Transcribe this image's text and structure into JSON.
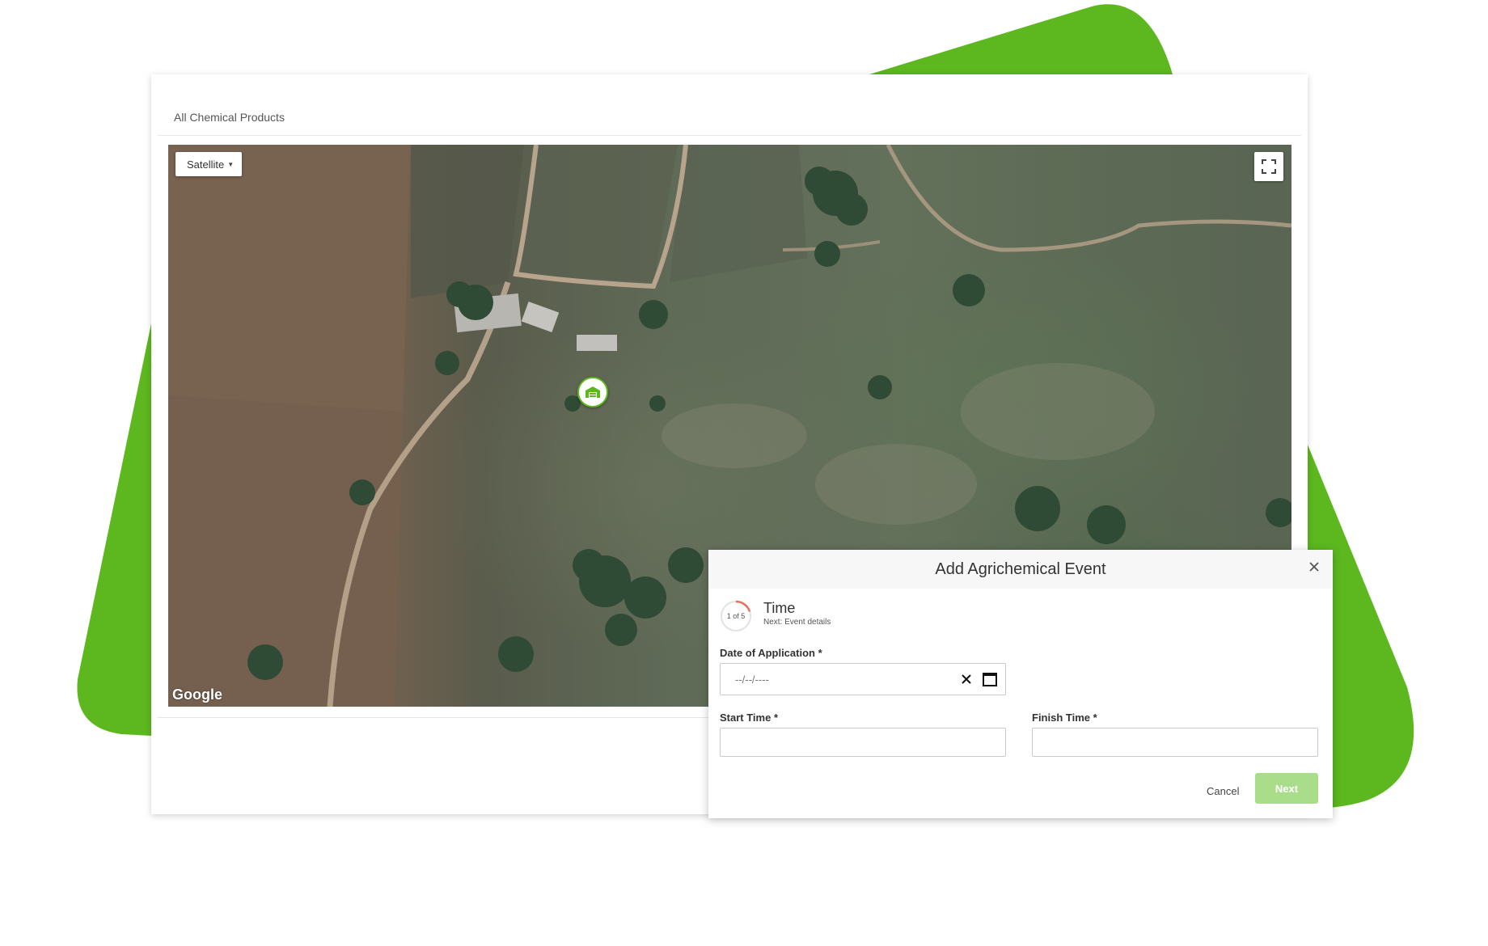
{
  "colors": {
    "brand_green": "#5cb81e",
    "next_disabled": "#a9dd89",
    "step_progress": "#e57363"
  },
  "panel": {
    "title": "All Chemical Products"
  },
  "map": {
    "type_button": "Satellite",
    "fullscreen_icon": "fullscreen-icon",
    "attribution": "Google",
    "marker_icon": "warehouse-icon"
  },
  "modal": {
    "title": "Add Agrichemical Event",
    "close_icon": "close-icon",
    "step": {
      "count": "1 of 5",
      "current_step": 1,
      "total_steps": 5,
      "title": "Time",
      "next": "Next: Event details"
    },
    "date_label": "Date of Application *",
    "date_placeholder": "--/--/----",
    "start_label": "Start Time *",
    "finish_label": "Finish Time *",
    "start_value": "",
    "finish_value": "",
    "cancel": "Cancel",
    "next_button": "Next"
  }
}
